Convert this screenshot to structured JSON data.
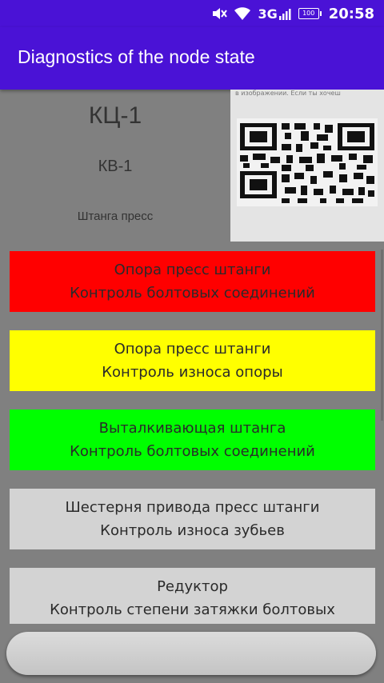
{
  "status_bar": {
    "network": "3G",
    "battery": "100",
    "time": "20:58",
    "icons": [
      "mute-icon",
      "wifi-icon",
      "signal-icon",
      "battery-icon"
    ]
  },
  "app_bar": {
    "title": "Diagnostics of the node state",
    "color": "#4a12d6"
  },
  "node": {
    "code": "КЦ-1",
    "sub_code": "КВ-1",
    "name": "Штанга пресс"
  },
  "qr_image": {
    "caption": "в изображении. Если ты хочеш"
  },
  "tasks": [
    {
      "title": "Опора пресс штанги",
      "subtitle": "Контроль болтовых соединений",
      "status_color": "#ff0000"
    },
    {
      "title": "Опора пресс штанги",
      "subtitle": "Контроль износа опоры",
      "status_color": "#ffff00"
    },
    {
      "title": "Выталкивающая штанга",
      "subtitle": "Контроль болтовых соединений",
      "status_color": "#00ff00"
    },
    {
      "title": "Шестерня привода пресс штанги",
      "subtitle": "Контроль износа зубьев",
      "status_color": "#d3d3d3"
    },
    {
      "title": "Редуктор",
      "subtitle": "Контроль степени затяжки болтовых",
      "status_color": "#d3d3d3"
    }
  ],
  "bottom_button": {
    "label": ""
  }
}
